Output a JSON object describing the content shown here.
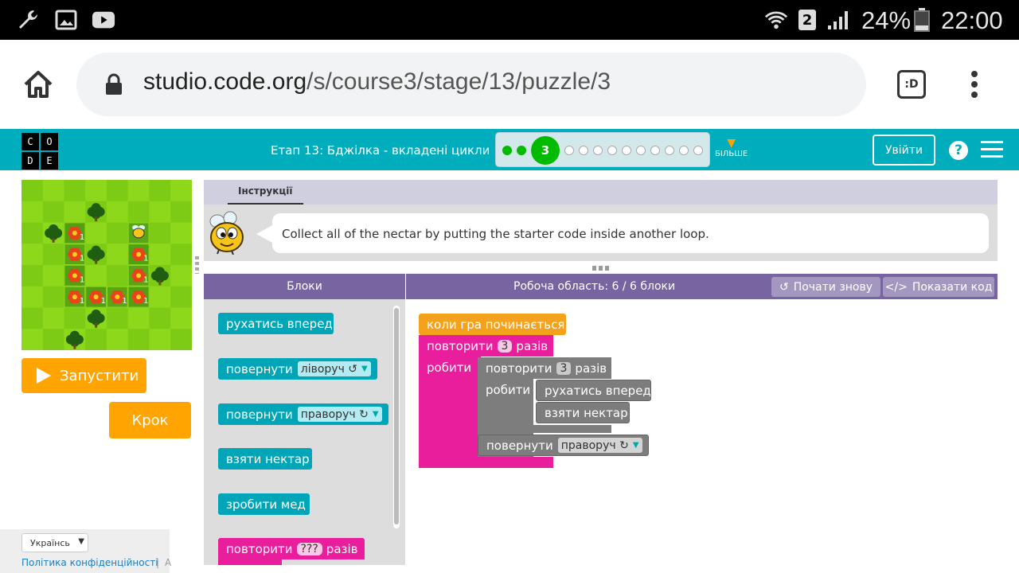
{
  "status_bar": {
    "battery": "24%",
    "time": "22:00",
    "sim": "2"
  },
  "browser": {
    "host": "studio.code.org",
    "path": "/s/course3/stage/13/puzzle/3",
    "tab_badge": ":D"
  },
  "header": {
    "logo_letters": [
      "C",
      "O",
      "D",
      "E"
    ],
    "stage_title": "Етап 13: Бджілка - вкладені цикли",
    "current_puzzle": "3",
    "more_label": "БІЛЬШЕ",
    "signin_label": "Увійти",
    "help_icon": "?"
  },
  "game": {
    "run_label": "Запустити",
    "step_label": "Крок",
    "flower_count_label": "1"
  },
  "footer": {
    "language": "Українсь",
    "privacy_link": "Політика конфіденційності",
    "separator": "|",
    "trailing": "А"
  },
  "instructions": {
    "tab_label": "Інструкції",
    "text": "Collect all of the nectar by putting the starter code inside another loop."
  },
  "toolbox": {
    "header": "Блоки",
    "blocks": {
      "move": "рухатись вперед",
      "turn_left": "повернути",
      "turn_left_value": "ліворуч ↺",
      "turn_right": "повернути",
      "turn_right_value": "праворуч ↻",
      "get_nectar": "взяти нектар",
      "make_honey": "зробити мед",
      "repeat": "повторити",
      "repeat_value": "???",
      "repeat_suffix": "разів"
    }
  },
  "workspace": {
    "header": "Робоча область: 6 / 6 блоки",
    "start_over": "Почати знову",
    "show_code": "Показати код",
    "when_run": "коли гра починається",
    "outer_repeat": "повторити",
    "outer_count": "3",
    "times": "разів",
    "do": "робити",
    "inner_repeat": "повторити",
    "inner_count": "3",
    "inner_times": "разів",
    "inner_do": "робити",
    "move": "рухатись вперед",
    "get_nectar": "взяти нектар",
    "turn": "повернути",
    "turn_value": "праворуч ↻"
  }
}
